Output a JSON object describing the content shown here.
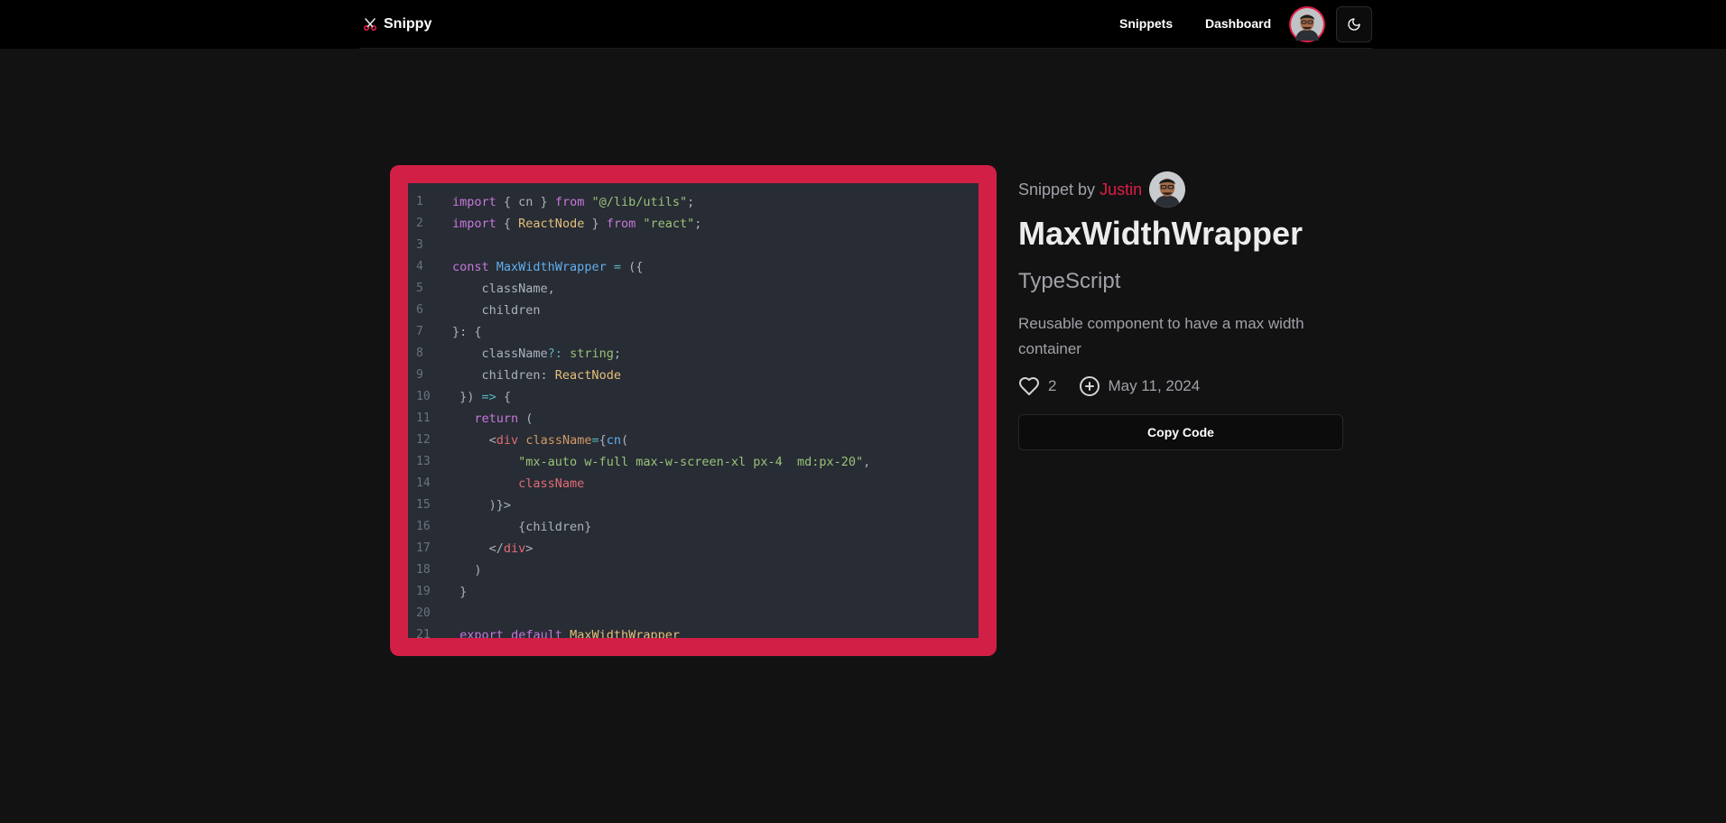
{
  "nav": {
    "brand": "Snippy",
    "links": [
      "Snippets",
      "Dashboard"
    ]
  },
  "snippet": {
    "byline_prefix": "Snippet by",
    "author": "Justin",
    "title": "MaxWidthWrapper",
    "language": "TypeScript",
    "description": "Reusable component to have a max width container",
    "likes": "2",
    "date": "May 11, 2024",
    "copy_label": "Copy Code"
  },
  "code": {
    "lines": [
      [
        [
          "import",
          "kw"
        ],
        [
          " { cn } ",
          "plain"
        ],
        [
          "from",
          "kw"
        ],
        [
          " ",
          "plain"
        ],
        [
          "\"@/lib/utils\"",
          "str"
        ],
        [
          ";",
          "plain"
        ]
      ],
      [
        [
          "import",
          "kw"
        ],
        [
          " { ",
          "plain"
        ],
        [
          "ReactNode",
          "type"
        ],
        [
          " } ",
          "plain"
        ],
        [
          "from",
          "kw"
        ],
        [
          " ",
          "plain"
        ],
        [
          "\"react\"",
          "str"
        ],
        [
          ";",
          "plain"
        ]
      ],
      [],
      [
        [
          "const",
          "kw"
        ],
        [
          " ",
          "plain"
        ],
        [
          "MaxWidthWrapper",
          "fn"
        ],
        [
          " ",
          "plain"
        ],
        [
          "=",
          "op"
        ],
        [
          " ({",
          "plain"
        ]
      ],
      [
        [
          "    className,",
          "plain"
        ]
      ],
      [
        [
          "    children",
          "plain"
        ]
      ],
      [
        [
          "}: {",
          "plain"
        ]
      ],
      [
        [
          "    className",
          "plain"
        ],
        [
          "?:",
          "op"
        ],
        [
          " ",
          "plain"
        ],
        [
          "string",
          "str"
        ],
        [
          ";",
          "plain"
        ]
      ],
      [
        [
          "    children: ",
          "plain"
        ],
        [
          "ReactNode",
          "type"
        ]
      ],
      [
        [
          " }) ",
          "plain"
        ],
        [
          "=>",
          "op"
        ],
        [
          " {",
          "plain"
        ]
      ],
      [
        [
          "   ",
          "plain"
        ],
        [
          "return",
          "kw"
        ],
        [
          " (",
          "plain"
        ]
      ],
      [
        [
          "     <",
          "plain"
        ],
        [
          "div",
          "tag"
        ],
        [
          " ",
          "plain"
        ],
        [
          "className",
          "attr"
        ],
        [
          "=",
          "op"
        ],
        [
          "{",
          "plain"
        ],
        [
          "cn",
          "fn"
        ],
        [
          "(",
          "plain"
        ]
      ],
      [
        [
          "         ",
          "plain"
        ],
        [
          "\"mx-auto w-full max-w-screen-xl px-4  md:px-20\"",
          "str"
        ],
        [
          ",",
          "plain"
        ]
      ],
      [
        [
          "         ",
          "plain"
        ],
        [
          "className",
          "tag"
        ]
      ],
      [
        [
          "     )}>",
          "plain"
        ]
      ],
      [
        [
          "         {children}",
          "plain"
        ]
      ],
      [
        [
          "     </",
          "plain"
        ],
        [
          "div",
          "tag"
        ],
        [
          ">",
          "plain"
        ]
      ],
      [
        [
          "   )",
          "plain"
        ]
      ],
      [
        [
          " }",
          "plain"
        ]
      ],
      [],
      [
        [
          " ",
          "plain"
        ],
        [
          "export",
          "kw"
        ],
        [
          " ",
          "plain"
        ],
        [
          "default",
          "kw"
        ],
        [
          " ",
          "plain"
        ],
        [
          "MaxWidthWrapper",
          "type"
        ]
      ]
    ]
  }
}
